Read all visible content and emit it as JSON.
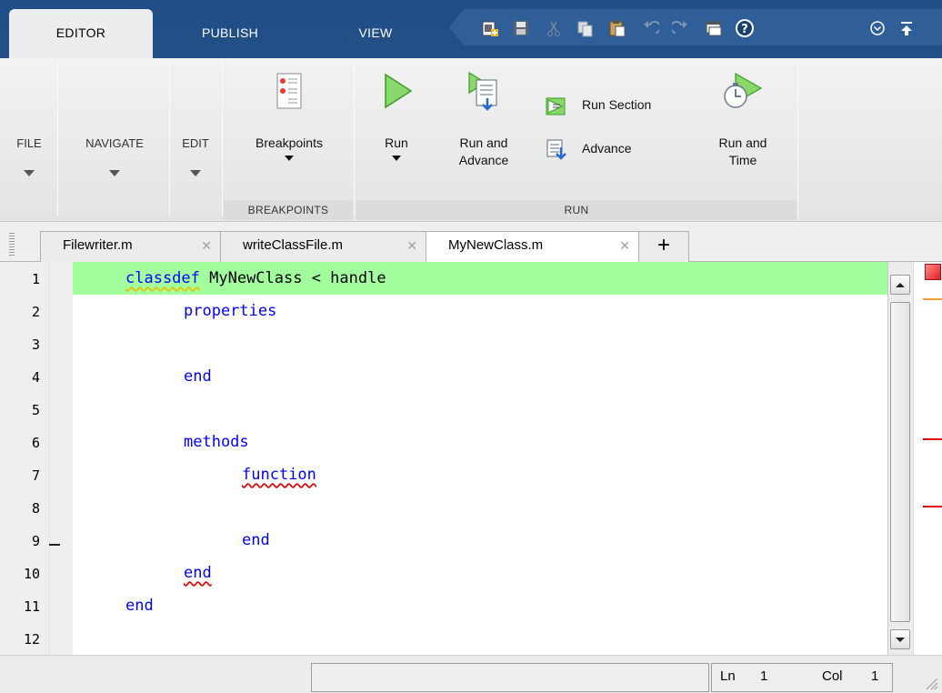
{
  "toolstrip": {
    "tabs": [
      {
        "label": "EDITOR",
        "active": true
      },
      {
        "label": "PUBLISH",
        "active": false
      },
      {
        "label": "VIEW",
        "active": false
      }
    ],
    "quick_access": [
      "new-file-icon",
      "save-icon",
      "cut-icon",
      "copy-icon",
      "paste-icon",
      "undo-icon",
      "redo-icon",
      "switch-windows-icon",
      "help-icon",
      "expand-menu-icon",
      "minimize-toolstrip-icon"
    ]
  },
  "ribbon": {
    "file": "FILE",
    "navigate": "NAVIGATE",
    "edit": "EDIT",
    "breakpoints_button": "Breakpoints",
    "breakpoints_group": "BREAKPOINTS",
    "run_button": "Run",
    "run_and_advance": [
      "Run and",
      "Advance"
    ],
    "run_section": "Run Section",
    "advance": "Advance",
    "run_and_time": [
      "Run and",
      "Time"
    ],
    "run_group": "RUN"
  },
  "file_tabs": [
    {
      "name": "Filewriter.m",
      "active": false
    },
    {
      "name": "writeClassFile.m",
      "active": false
    },
    {
      "name": "MyNewClass.m",
      "active": true
    }
  ],
  "add_tab": "+",
  "editor": {
    "lines": [
      {
        "n": "1",
        "text": "classdef MyNewClass < handle"
      },
      {
        "n": "2",
        "text": "properties"
      },
      {
        "n": "3",
        "text": ""
      },
      {
        "n": "4",
        "text": "end"
      },
      {
        "n": "5",
        "text": ""
      },
      {
        "n": "6",
        "text": "methods"
      },
      {
        "n": "7",
        "text": "function"
      },
      {
        "n": "8",
        "text": ""
      },
      {
        "n": "9",
        "text": "end"
      },
      {
        "n": "10",
        "text": "end"
      },
      {
        "n": "11",
        "text": "end"
      },
      {
        "n": "12",
        "text": ""
      }
    ],
    "keyword_color": "#0000ff",
    "current_line_highlight": "#a3ff9e"
  },
  "status": {
    "ln_label": "Ln",
    "ln_value": "1",
    "col_label": "Col",
    "col_value": "1"
  }
}
